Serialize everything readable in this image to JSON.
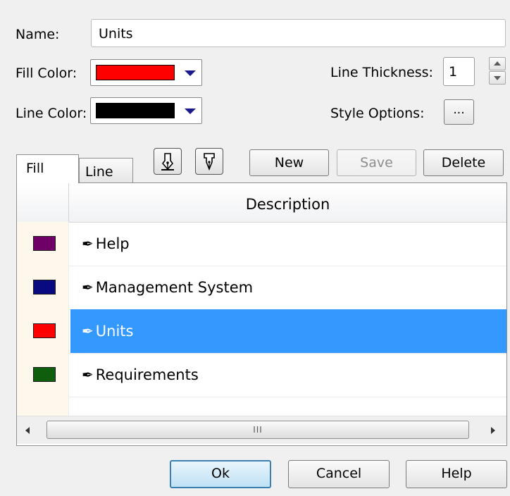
{
  "name": {
    "label": "Name:",
    "value": "Units"
  },
  "fill_color": {
    "label": "Fill Color:",
    "color": "#ff0000"
  },
  "line_color": {
    "label": "Line Color:",
    "color": "#000000"
  },
  "line_thickness": {
    "label": "Line Thickness:",
    "value": "1"
  },
  "style_options": {
    "label": "Style Options:",
    "button": "..."
  },
  "tabs": {
    "fill": "Fill",
    "line": "Line"
  },
  "toolbar": {
    "new": "New",
    "save": "Save",
    "delete": "Delete"
  },
  "grid": {
    "column_header": "Description",
    "rows": [
      {
        "label": "Help",
        "color": "#6f0067"
      },
      {
        "label": "Management System",
        "color": "#0a0a80"
      },
      {
        "label": "Units",
        "color": "#ff0000",
        "selected": true
      },
      {
        "label": "Requirements",
        "color": "#0e5e0e"
      }
    ],
    "scrollbar_grip": "III"
  },
  "footer": {
    "ok": "Ok",
    "cancel": "Cancel",
    "help": "Help"
  }
}
